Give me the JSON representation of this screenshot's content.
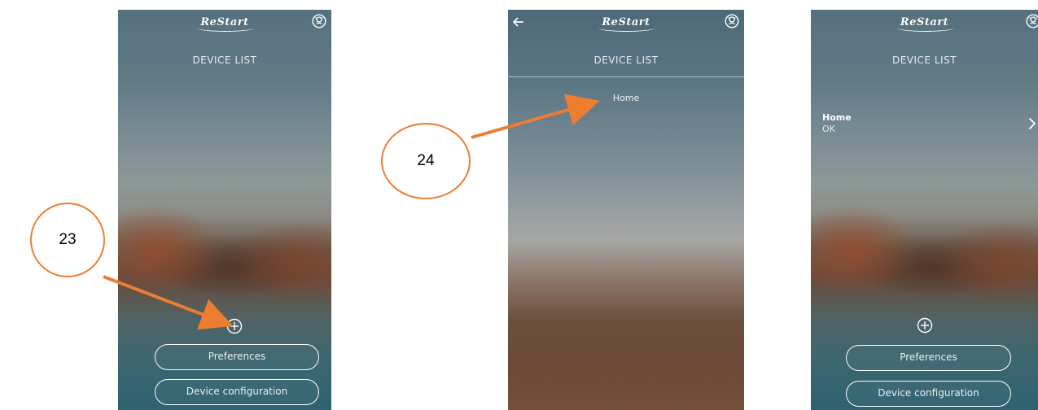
{
  "app": {
    "logo_text": "ReStart"
  },
  "screens": [
    {
      "title": "DEVICE LIST",
      "buttons": {
        "preferences": "Preferences",
        "device_configuration": "Device configuration"
      }
    },
    {
      "title": "DEVICE LIST",
      "list_item": "Home"
    },
    {
      "title": "DEVICE LIST",
      "device": {
        "name": "Home",
        "status": "OK"
      },
      "buttons": {
        "preferences": "Preferences",
        "device_configuration": "Device configuration"
      }
    }
  ],
  "annotations": {
    "callout_a": "23",
    "callout_b": "24",
    "color": "#ed7d31"
  },
  "icons": {
    "user": "user-circle-icon",
    "back": "arrow-left-icon",
    "add": "plus-circle-icon",
    "chevron": "chevron-right-icon"
  }
}
